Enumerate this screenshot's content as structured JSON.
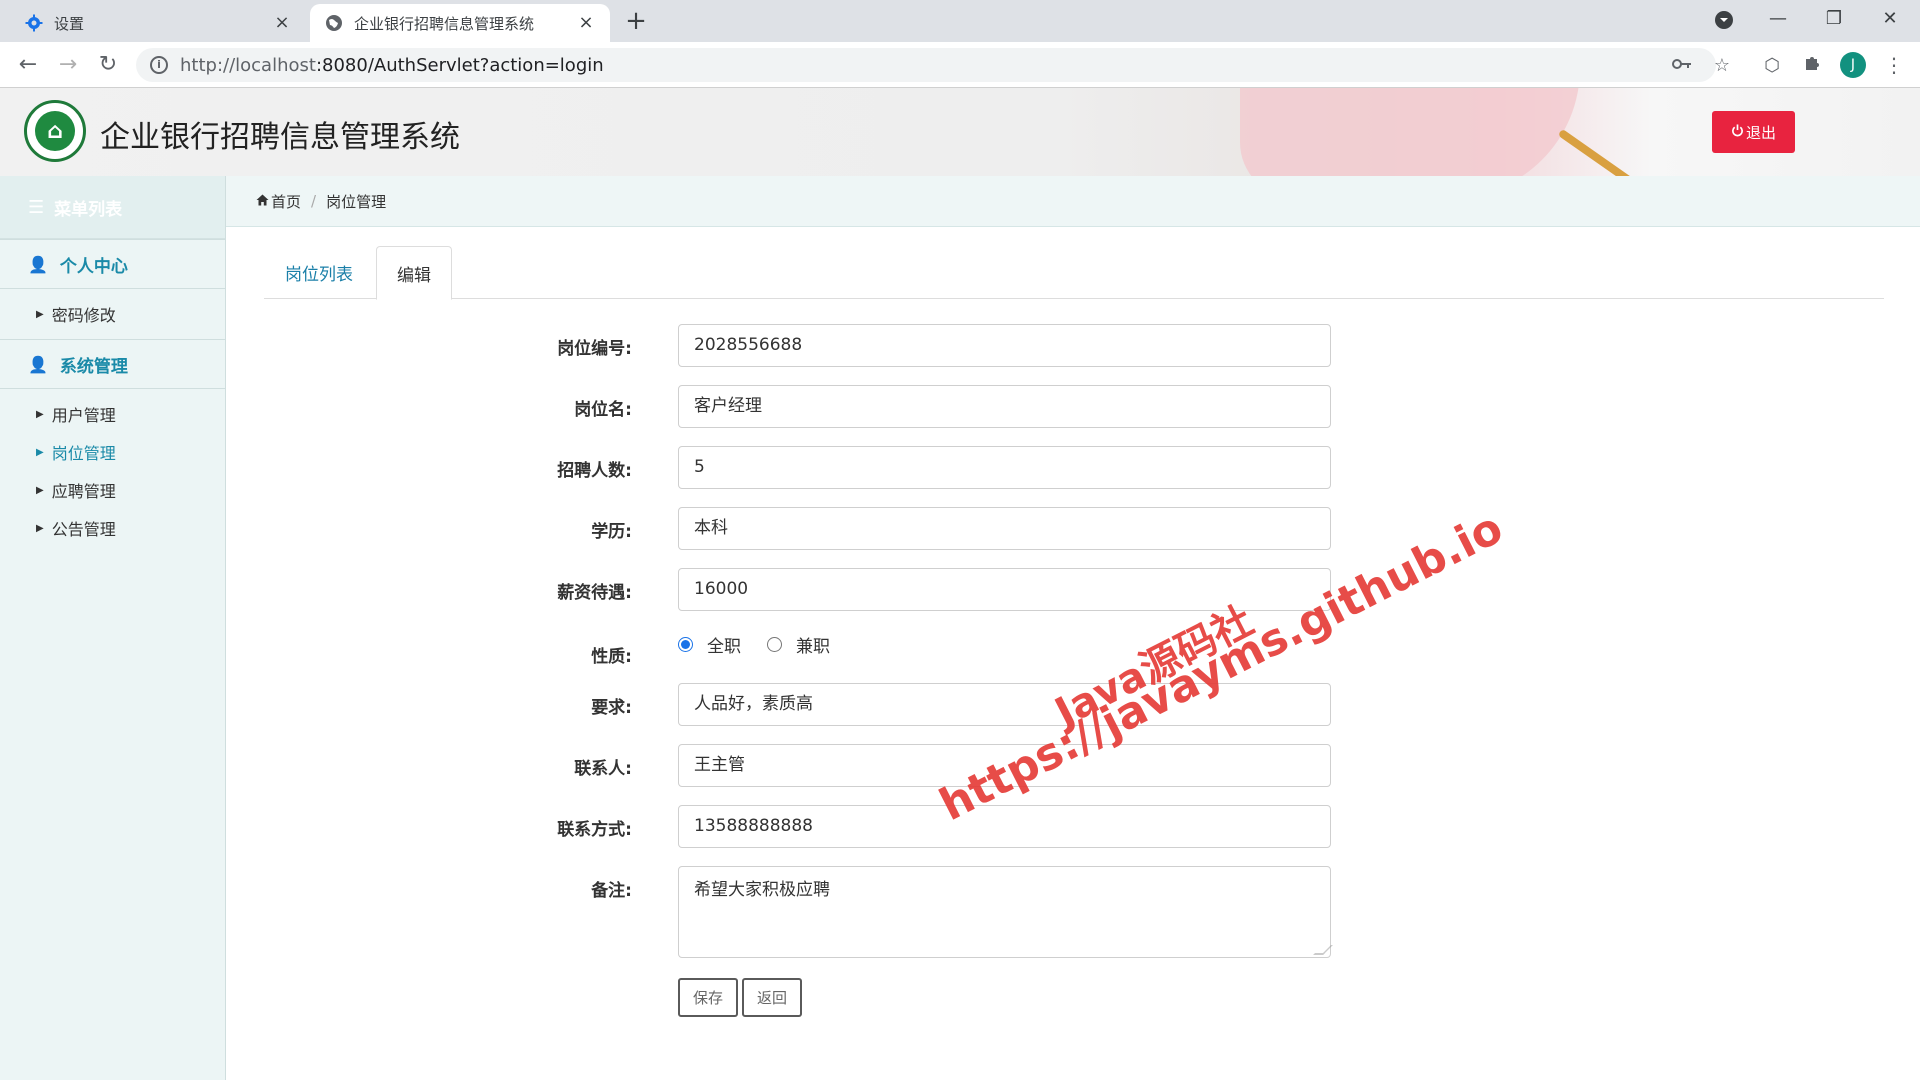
{
  "browser": {
    "tabs": [
      {
        "title": "设置",
        "close": "×"
      },
      {
        "title": "企业银行招聘信息管理系统",
        "close": "×"
      }
    ],
    "new_tab": "+",
    "url_host": "http://localhost",
    "url_rest": ":8080/AuthServlet?action=login",
    "avatar_letter": "J",
    "window_controls": [
      "—",
      "❐",
      "✕"
    ]
  },
  "header": {
    "title": "企业银行招聘信息管理系统",
    "logo_glyph": "⌂",
    "logout_label": "退出"
  },
  "sidebar": {
    "heading": "菜单列表",
    "groups": [
      {
        "label": "个人中心",
        "items": [
          "密码修改"
        ]
      },
      {
        "label": "系统管理",
        "items": [
          "用户管理",
          "岗位管理",
          "应聘管理",
          "公告管理"
        ]
      }
    ],
    "active_item": "岗位管理"
  },
  "breadcrumb": {
    "home": "首页",
    "current": "岗位管理"
  },
  "tabs": {
    "list": "岗位列表",
    "edit": "编辑"
  },
  "form": {
    "job_no": {
      "label": "岗位编号:",
      "value": "2028556688"
    },
    "job_name": {
      "label": "岗位名:",
      "value": "客户经理"
    },
    "headcount": {
      "label": "招聘人数:",
      "value": "5"
    },
    "education": {
      "label": "学历:",
      "value": "本科"
    },
    "salary": {
      "label": "薪资待遇:",
      "value": "16000"
    },
    "nature": {
      "label": "性质:",
      "options": [
        "全职",
        "兼职"
      ],
      "selected": "全职"
    },
    "requirement": {
      "label": "要求:",
      "value": "人品好，素质高"
    },
    "contact": {
      "label": "联系人:",
      "value": "王主管"
    },
    "phone": {
      "label": "联系方式:",
      "value": "13588888888"
    },
    "remark": {
      "label": "备注:",
      "value": "希望大家积极应聘"
    },
    "save_label": "保存",
    "back_label": "返回"
  },
  "watermark": {
    "line1": "Java源码社",
    "line2": "https://javayms.github.io"
  },
  "colors": {
    "accent": "#1a8aa8",
    "logout": "#e8233f",
    "watermark": "#e53935"
  }
}
